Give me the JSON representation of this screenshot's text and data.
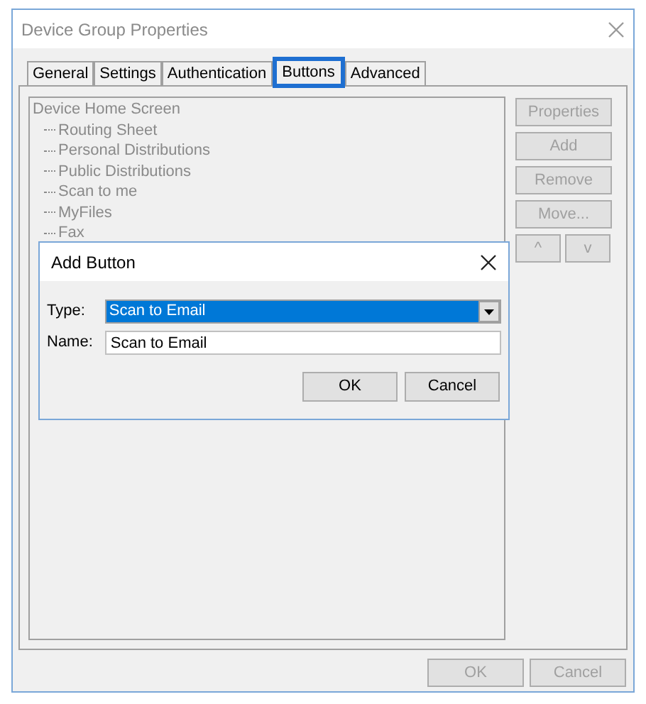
{
  "window": {
    "title": "Device Group Properties"
  },
  "tabs": [
    {
      "label": "General",
      "selected": false
    },
    {
      "label": "Settings",
      "selected": false
    },
    {
      "label": "Authentication",
      "selected": false
    },
    {
      "label": "Buttons",
      "selected": true
    },
    {
      "label": "Advanced",
      "selected": false
    }
  ],
  "tree": {
    "label": "Device Home Screen",
    "children": [
      {
        "label": "Routing Sheet"
      },
      {
        "label": "Personal Distributions"
      },
      {
        "label": "Public Distributions"
      },
      {
        "label": "Scan to me"
      },
      {
        "label": "MyFiles"
      },
      {
        "label": "Fax"
      }
    ]
  },
  "side_buttons": [
    {
      "label": "Properties",
      "disabled": true
    },
    {
      "label": "Add",
      "disabled": true
    },
    {
      "label": "Remove",
      "disabled": true
    },
    {
      "label": "Move...",
      "disabled": true
    }
  ],
  "order_buttons": [
    {
      "label": "^",
      "disabled": true
    },
    {
      "label": "v",
      "disabled": true
    }
  ],
  "footer_buttons": [
    {
      "label": "OK",
      "disabled": true
    },
    {
      "label": "Cancel",
      "disabled": true
    }
  ],
  "dialog": {
    "title": "Add Button",
    "type_label": "Type:",
    "type_value": "Scan to Email",
    "name_label": "Name:",
    "name_value": "Scan to Email",
    "buttons": [
      {
        "label": "OK"
      },
      {
        "label": "Cancel"
      }
    ]
  }
}
